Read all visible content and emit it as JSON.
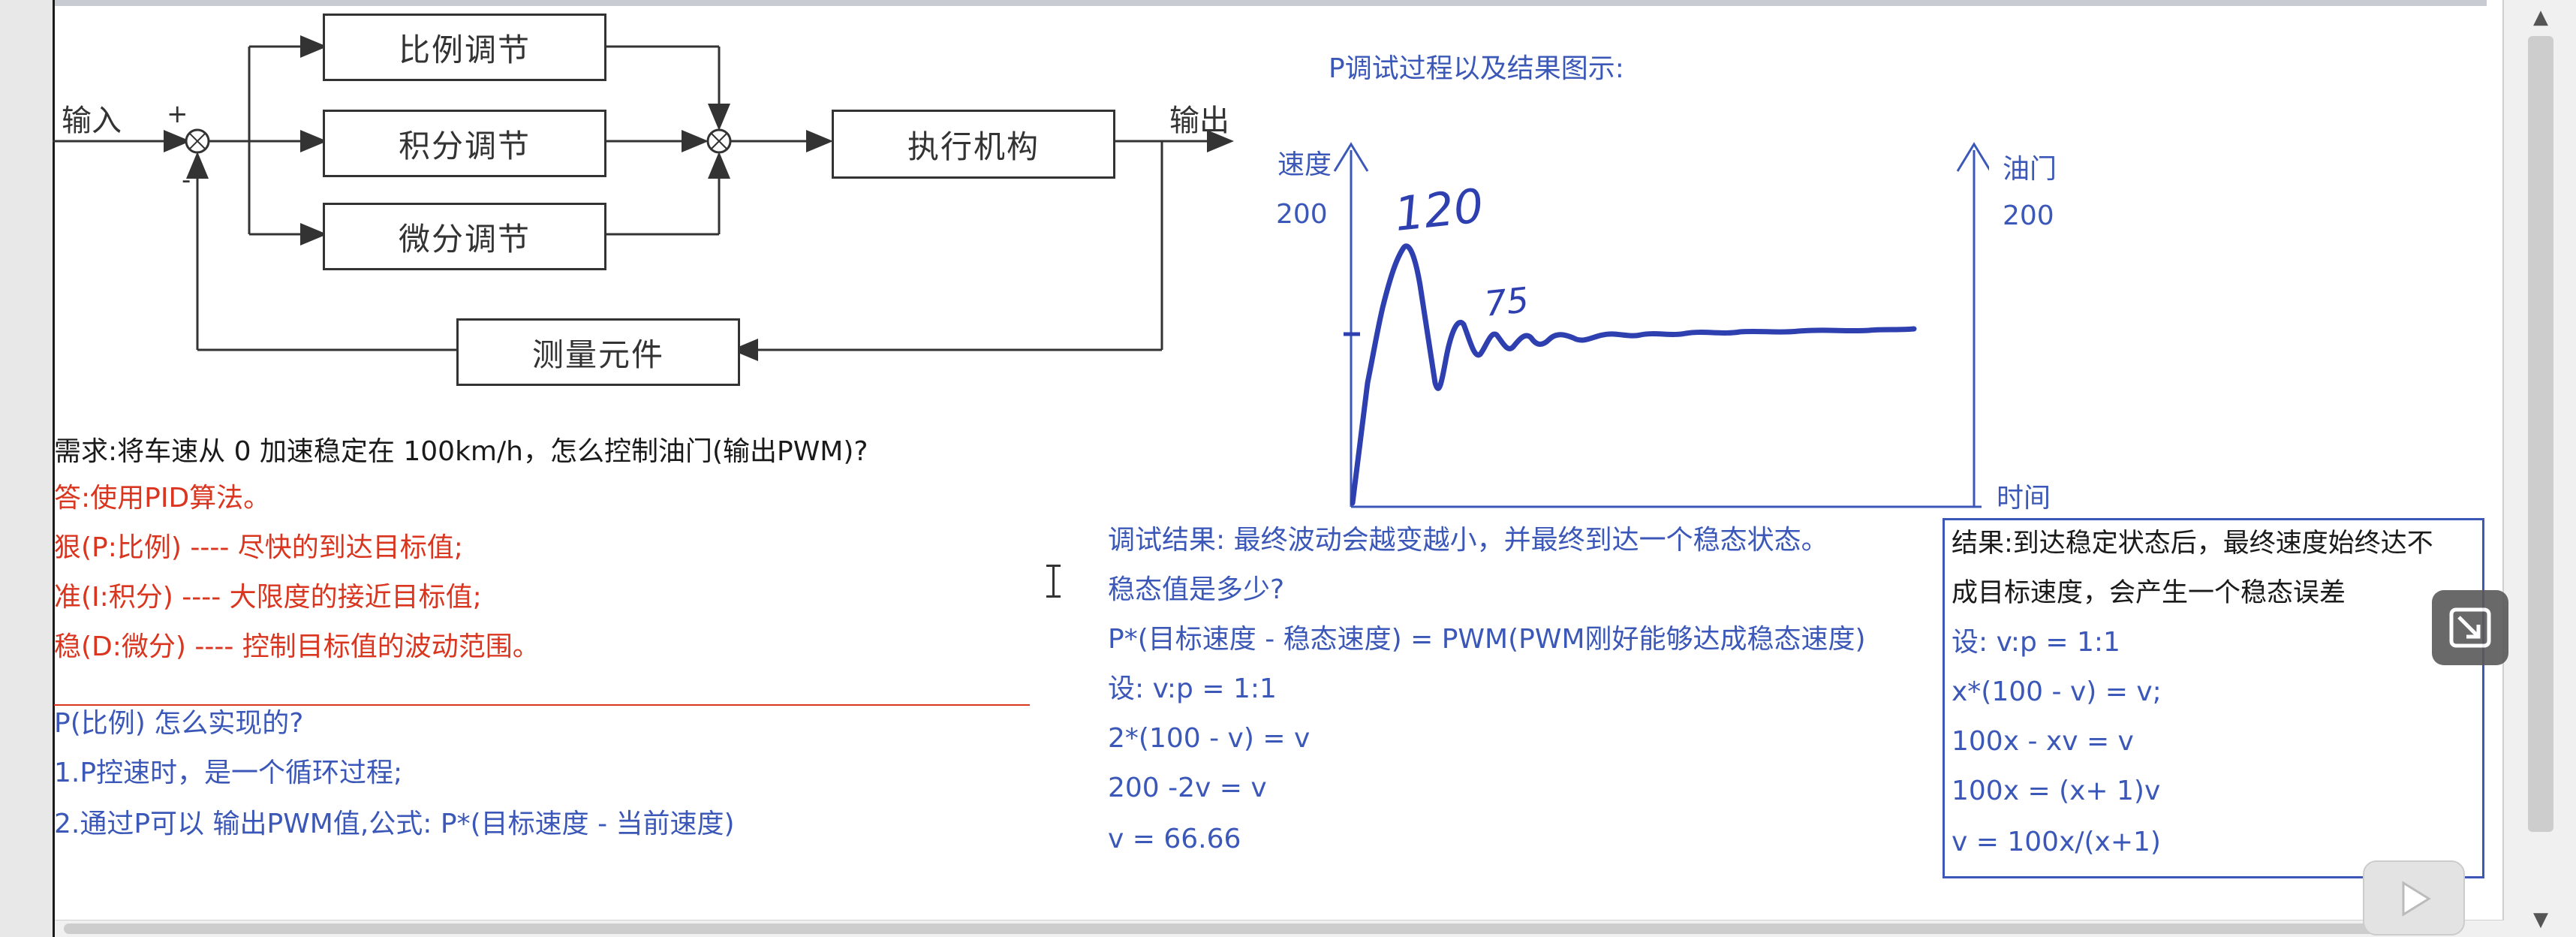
{
  "diagram": {
    "blocks": {
      "proportional": "比例调节",
      "integral": "积分调节",
      "derivative": "微分调节",
      "actuator": "执行机构",
      "sensor": "测量元件"
    },
    "input_label": "输入",
    "output_label": "输出",
    "plus_sign": "+",
    "minus_sign": "-"
  },
  "notes_left": {
    "requirement": "需求:将车速从 0 加速稳定在 100km/h，怎么控制油门(输出PWM)?",
    "answer": "答:使用PID算法。",
    "p_line": "狠(P:比例) ---- 尽快的到达目标值;",
    "i_line": "准(I:积分)  ---- 大限度的接近目标值;",
    "d_line": "稳(D:微分) ---- 控制目标值的波动范围。",
    "p_how_title": "P(比例) 怎么实现的?",
    "p_how_1": "1.P控速时，是一个循环过程;",
    "p_how_2": "2.通过P可以 输出PWM值,公式: P*(目标速度 - 当前速度)"
  },
  "chart_section": {
    "title": "P调试过程以及结果图示:",
    "left_axis_label": "速度",
    "left_axis_value": "200",
    "right_axis_label": "油门",
    "right_axis_value": "200",
    "x_axis_label": "时间",
    "peak1_annotation": "120",
    "peak2_annotation": "75",
    "colors": {
      "ink": "#2e3fb0",
      "axis": "#3b58b8"
    }
  },
  "notes_middle": {
    "result": "调试结果: 最终波动会越变越小，并最终到达一个稳态状态。",
    "question": "稳态值是多少?",
    "formula": "P*(目标速度 - 稳态速度) = PWM(PWM刚好能够达成稳态速度)",
    "assume": "设: v:p = 1:1",
    "eq1": "2*(100 - v) = v",
    "eq2": "200 -2v = v",
    "eq3": "v = 66.66"
  },
  "notes_right": {
    "result_line1": "结果:到达稳定状态后，最终速度始终达不",
    "result_line2": "成目标速度，会产生一个稳态误差",
    "assume": "设: v:p = 1:1",
    "eq1": "x*(100 - v) = v;",
    "eq2": "100x - xv = v",
    "eq3": "100x = (x+ 1)v",
    "eq4": "v = 100x/(x+1)"
  },
  "ui": {
    "scroll_up": "▲",
    "scroll_down": "▼",
    "fab_icon": "exit-fullscreen-icon",
    "play_icon": "play-icon",
    "colors": {
      "red": "#d9351f",
      "blue": "#3b58b8",
      "text": "#1a1a1a"
    }
  }
}
